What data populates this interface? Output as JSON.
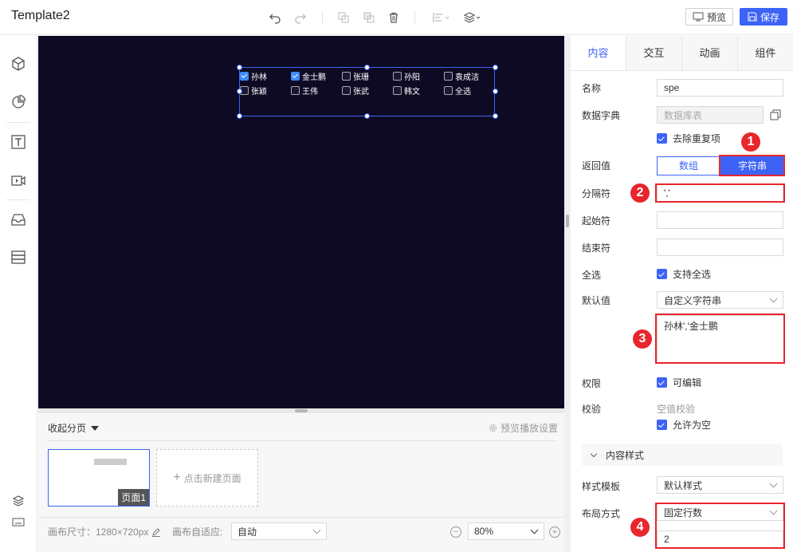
{
  "app": {
    "title": "Template2"
  },
  "toolbar": {
    "undo_icon": "undo-icon",
    "redo_icon": "redo-icon",
    "preview_label": "预览",
    "save_label": "保存",
    "accent": "#3d63f6"
  },
  "canvas": {
    "background": "#0f0a24",
    "checkboxes": [
      {
        "label": "孙林",
        "checked": true
      },
      {
        "label": "金士鹏",
        "checked": true
      },
      {
        "label": "张珊",
        "checked": false
      },
      {
        "label": "孙阳",
        "checked": false
      },
      {
        "label": "袁成洁",
        "checked": false
      },
      {
        "label": "张颖",
        "checked": false
      },
      {
        "label": "王伟",
        "checked": false
      },
      {
        "label": "张武",
        "checked": false
      },
      {
        "label": "韩文",
        "checked": false
      },
      {
        "label": "全选",
        "checked": false
      }
    ]
  },
  "pages": {
    "collapse_label": "收起分页",
    "play_settings_label": "预览播放设置",
    "page1_label": "页面1",
    "new_page_label": "点击新建页面",
    "canvas_size_label": "画布尺寸：1280×720px",
    "auto_fit_label": "画布自适应:",
    "auto_fit_value": "自动",
    "zoom_value": "80%"
  },
  "panel": {
    "tabs": [
      "内容",
      "交互",
      "动画",
      "组件"
    ],
    "name_label": "名称",
    "name_value": "spe",
    "dict_label": "数据字典",
    "dict_placeholder": "数据库表",
    "dedupe_label": "去除重复项",
    "return_label": "返回值",
    "return_options": [
      "数组",
      "字符串"
    ],
    "return_selected": "字符串",
    "separator_label": "分隔符",
    "separator_value": "','",
    "start_label": "起始符",
    "start_value": "",
    "end_label": "结束符",
    "end_value": "",
    "select_all_label": "全选",
    "select_all_option": "支持全选",
    "default_label": "默认值",
    "default_type": "自定义字符串",
    "default_value": "孙林','金士鹏",
    "permission_label": "权限",
    "permission_option": "可编辑",
    "validate_label": "校验",
    "validate_sub": "空值校验",
    "allow_empty_label": "允许为空",
    "style_section": "内容样式",
    "style_template_label": "样式模板",
    "style_template_value": "默认样式",
    "layout_label": "布局方式",
    "layout_value": "固定行数",
    "layout_rows": "2",
    "markers": [
      "1",
      "2",
      "3",
      "4"
    ],
    "highlight_color": "#e8262d"
  }
}
